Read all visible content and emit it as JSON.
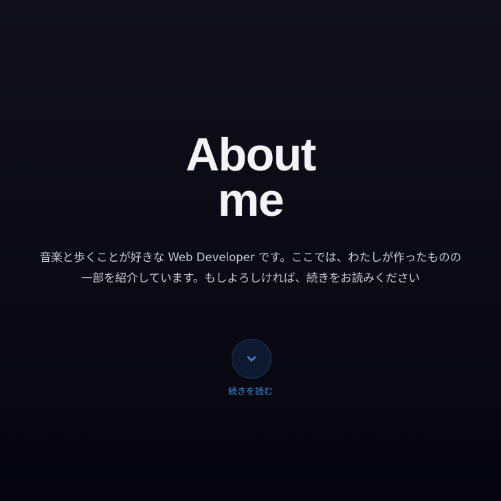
{
  "hero": {
    "title_line1": "About",
    "title_line2": "me",
    "intro_line1": "音楽と歩くことが好きな Web Developer です。ここでは、わたしが作ったものの",
    "intro_line2": "一部を紹介しています。もしよろしければ、続きをお読みください"
  },
  "scroll_cta": {
    "icon": "chevron-down-icon",
    "label": "続きを読む"
  },
  "colors": {
    "background_top": "#111019",
    "background_bottom": "#06050f",
    "title": "#f3f3f6",
    "body_text": "#c9c9d1",
    "accent": "#3f8fd6",
    "button_bg": "#0d1a30"
  }
}
